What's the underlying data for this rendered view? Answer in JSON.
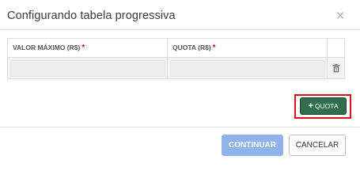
{
  "dialog": {
    "title": "Configurando tabela progressiva",
    "close_icon": "close-icon"
  },
  "table": {
    "columns": [
      {
        "label": "VALOR MÁXIMO (R$)",
        "required_marker": "*"
      },
      {
        "label": "QUOTA (R$)",
        "required_marker": "*"
      }
    ],
    "rows": [
      {
        "max_value": "",
        "quota": "",
        "action_icon": "trash-icon"
      }
    ]
  },
  "actions": {
    "add_quota_label": "QUOTA",
    "add_quota_icon": "plus-icon",
    "continue_label": "CONTINUAR",
    "cancel_label": "CANCELAR"
  },
  "colors": {
    "primary_green": "#2f6f4e",
    "continue_disabled_blue": "#8fb3ea",
    "highlight_red": "#d8141d",
    "required_red": "#d9001b"
  }
}
